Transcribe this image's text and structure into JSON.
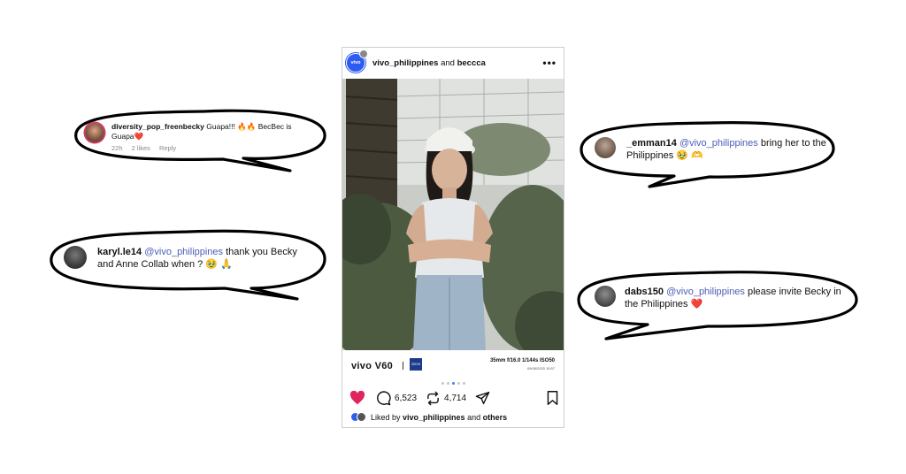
{
  "post": {
    "author": "vivo_philippines",
    "joiner": "and",
    "coauthor": "beccca",
    "more_icon": "more-horizontal-icon",
    "camera": {
      "brand": "vivo V60",
      "lens_badge": "ZEISS",
      "specs": "35mm  f/16.0  1/144s  ISO50",
      "date": "09/08/2025  15:57"
    },
    "carousel": {
      "count": 5,
      "active": 3
    },
    "comments_count": "6,523",
    "reposts_count": "4,714",
    "liked_prefix": "Liked by",
    "liked_user": "vivo_philippines",
    "liked_joiner": "and",
    "liked_others": "others",
    "colors": {
      "like": "#e0245e",
      "brand": "#2d5cf0",
      "mention": "#4a5db8"
    }
  },
  "comments": [
    {
      "username": "diversity_pop_freenbecky",
      "text": "Guapa!!! 🔥🔥 BecBec is Guapa❤️",
      "time": "22h",
      "likes": "2 likes",
      "reply": "Reply"
    },
    {
      "username": "karyl.le14",
      "mention": "@vivo_philippines",
      "text": "thank you Becky and Anne Collab when ? 🥹 🙏"
    },
    {
      "username": "_emman14",
      "mention": "@vivo_philippines",
      "text": "bring her to the Philippines 🥹 🫶"
    },
    {
      "username": "dabs150",
      "mention": "@vivo_philippines",
      "text": "please invite Becky in the Philippines ❤️"
    }
  ]
}
